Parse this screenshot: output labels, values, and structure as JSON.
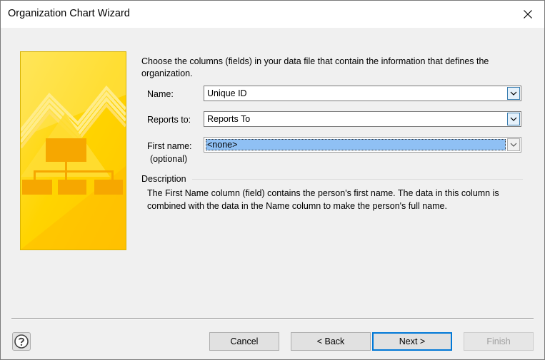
{
  "window": {
    "title": "Organization Chart Wizard"
  },
  "instructions": "Choose the columns (fields) in your data file that contain the information that defines the organization.",
  "fields": {
    "name": {
      "label": "Name:",
      "value": "Unique ID"
    },
    "reports_to": {
      "label": "Reports to:",
      "value": "Reports To"
    },
    "first_name": {
      "label": "First name:",
      "sublabel": "(optional)",
      "value": "<none>"
    }
  },
  "description": {
    "heading": "Description",
    "text": "The First Name column (field) contains the person's first name. The data in this column is combined with the data in the Name column to make the person's full name."
  },
  "buttons": {
    "cancel": "Cancel",
    "back": "< Back",
    "next": "Next >",
    "finish": "Finish"
  },
  "icons": {
    "close": "close-icon",
    "help": "help-icon",
    "dropdown": "chevron-down-icon"
  },
  "colors": {
    "accent": "#0078d7",
    "selection": "#8fc0f4",
    "banner": "#ffd200"
  }
}
